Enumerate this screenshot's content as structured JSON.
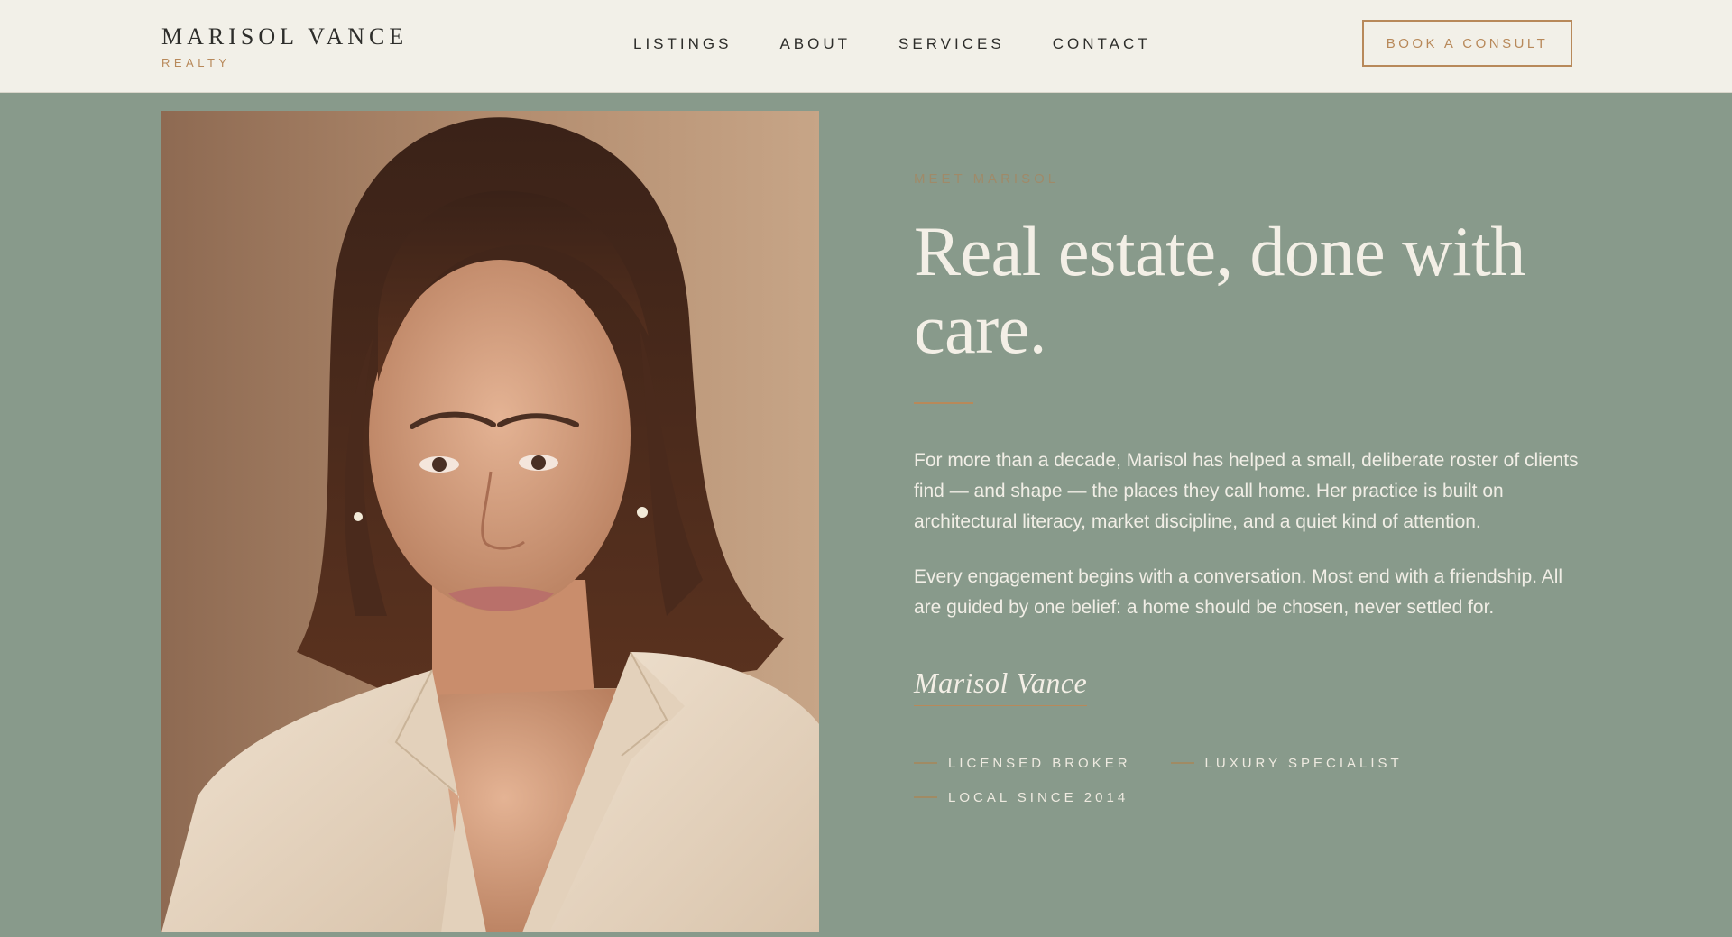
{
  "brand": {
    "name": "MARISOL VANCE",
    "sub": "REALTY"
  },
  "nav": {
    "items": [
      {
        "label": "LISTINGS"
      },
      {
        "label": "ABOUT"
      },
      {
        "label": "SERVICES"
      },
      {
        "label": "CONTACT"
      }
    ]
  },
  "cta": {
    "label": "BOOK A CONSULT"
  },
  "hero": {
    "eyebrow": "MEET MARISOL",
    "headline": "Real estate, done with care.",
    "paragraphs": [
      "For more than a decade, Marisol has helped a small, deliberate roster of clients find — and shape — the places they call home. Her practice is built on architectural literacy, market discipline, and a quiet kind of attention.",
      "Every engagement begins with a conversation. Most end with a friendship. All are guided by one belief: a home should be chosen, never settled for."
    ],
    "signature": "Marisol Vance",
    "credentials": [
      {
        "label": "LICENSED BROKER"
      },
      {
        "label": "LUXURY SPECIALIST"
      },
      {
        "label": "LOCAL SINCE 2014"
      }
    ]
  },
  "colors": {
    "header_bg": "#f2f0e8",
    "page_bg": "#889a8b",
    "accent": "#b8895a",
    "text_light": "#f3efe6",
    "text_dark": "#2e2e2b"
  }
}
